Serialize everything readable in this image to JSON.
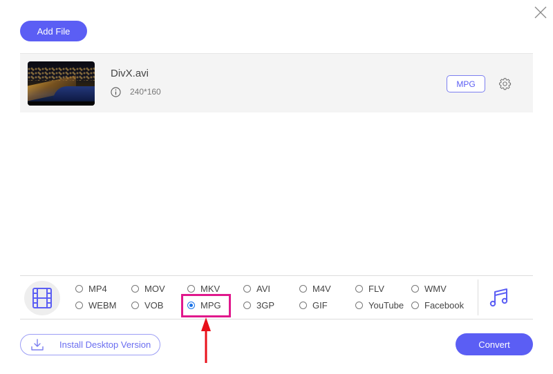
{
  "window": {
    "close_icon": "close-x-icon"
  },
  "toolbar": {
    "add_file_label": "Add File"
  },
  "file": {
    "name": "DivX.avi",
    "info_icon": "info-circle-icon",
    "resolution": "240*160",
    "output_format": "MPG",
    "settings_icon": "gear-icon",
    "thumbnail": "night city harbor video thumbnail"
  },
  "format_panel": {
    "video_tab_icon": "film-strip-icon",
    "audio_tab_icon": "music-note-icon",
    "selected": "MPG",
    "options": [
      {
        "label": "MP4",
        "checked": false
      },
      {
        "label": "MOV",
        "checked": false
      },
      {
        "label": "MKV",
        "checked": false
      },
      {
        "label": "AVI",
        "checked": false
      },
      {
        "label": "M4V",
        "checked": false
      },
      {
        "label": "FLV",
        "checked": false
      },
      {
        "label": "WMV",
        "checked": false
      },
      {
        "label": "WEBM",
        "checked": false
      },
      {
        "label": "VOB",
        "checked": false
      },
      {
        "label": "MPG",
        "checked": true
      },
      {
        "label": "3GP",
        "checked": false
      },
      {
        "label": "GIF",
        "checked": false
      },
      {
        "label": "YouTube",
        "checked": false
      },
      {
        "label": "Facebook",
        "checked": false
      }
    ]
  },
  "annotation": {
    "highlight_color": "#e0188c",
    "arrow_color": "#e8101a",
    "target": "MPG"
  },
  "footer": {
    "install_label": "Install Desktop Version",
    "install_icon": "download-icon",
    "convert_label": "Convert"
  },
  "colors": {
    "accent": "#5b5ef4",
    "radio_selected": "#1a73e8"
  }
}
